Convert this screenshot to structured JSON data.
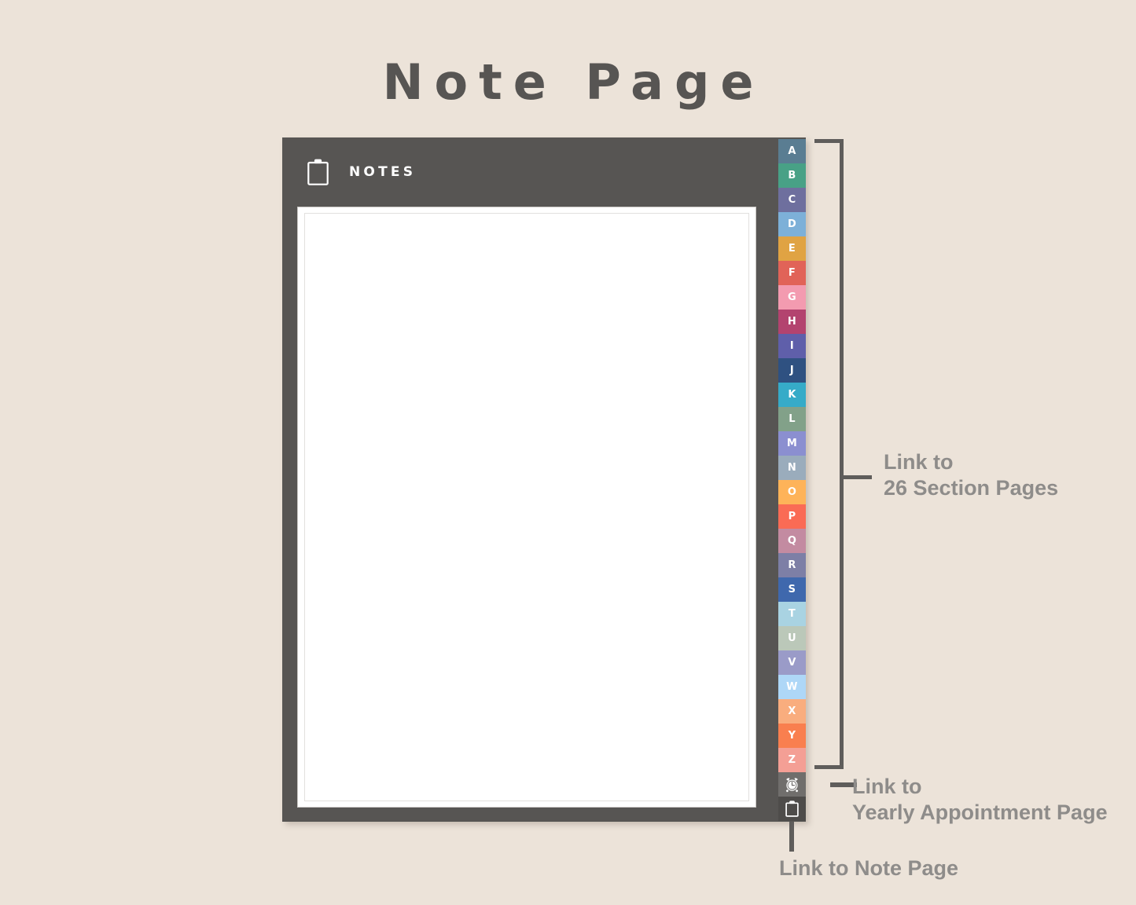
{
  "page": {
    "title": "Note Page",
    "background_color": "#ece3d9",
    "title_color": "#575553"
  },
  "planner": {
    "panel_color": "#575553",
    "header": {
      "icon": "clipboard-icon",
      "label": "NOTES"
    },
    "notes_area": {
      "line_count": 30,
      "background_color": "#ffffff",
      "line_color": "#d4d2d0"
    }
  },
  "alphabet_tabs": [
    {
      "letter": "A",
      "color": "#5a7d92"
    },
    {
      "letter": "B",
      "color": "#48a186"
    },
    {
      "letter": "C",
      "color": "#6e6f9e"
    },
    {
      "letter": "D",
      "color": "#7db0d8"
    },
    {
      "letter": "E",
      "color": "#e0a343"
    },
    {
      "letter": "F",
      "color": "#e16358"
    },
    {
      "letter": "G",
      "color": "#f39bb0"
    },
    {
      "letter": "H",
      "color": "#b3436f"
    },
    {
      "letter": "I",
      "color": "#5f5faa"
    },
    {
      "letter": "J",
      "color": "#2f5181"
    },
    {
      "letter": "K",
      "color": "#36abc8"
    },
    {
      "letter": "L",
      "color": "#82a189"
    },
    {
      "letter": "M",
      "color": "#8b8fd0"
    },
    {
      "letter": "N",
      "color": "#9aacbc"
    },
    {
      "letter": "O",
      "color": "#feb359"
    },
    {
      "letter": "P",
      "color": "#fa6b55"
    },
    {
      "letter": "Q",
      "color": "#c38ba1"
    },
    {
      "letter": "R",
      "color": "#7d7fa6"
    },
    {
      "letter": "S",
      "color": "#3f68ad"
    },
    {
      "letter": "T",
      "color": "#a9d3e2"
    },
    {
      "letter": "U",
      "color": "#bbc8b9"
    },
    {
      "letter": "V",
      "color": "#9a9bc8"
    },
    {
      "letter": "W",
      "color": "#aed7f7"
    },
    {
      "letter": "X",
      "color": "#f9ad7e"
    },
    {
      "letter": "Y",
      "color": "#f97f4f"
    },
    {
      "letter": "Z",
      "color": "#f49f95"
    }
  ],
  "quick_icons": [
    {
      "name": "alarm-clock-icon",
      "background": "#706e6c"
    },
    {
      "name": "clipboard-icon",
      "background": "#4e4c4a"
    }
  ],
  "annotations": {
    "sections": {
      "line1": "Link to",
      "line2": "26 Section Pages"
    },
    "appointment": {
      "line1": "Link to",
      "line2": "Yearly Appointment Page"
    },
    "notepage": {
      "line1": "Link to Note Page"
    },
    "color": "#8e8c8a",
    "connector_color": "#5f5d5b"
  }
}
